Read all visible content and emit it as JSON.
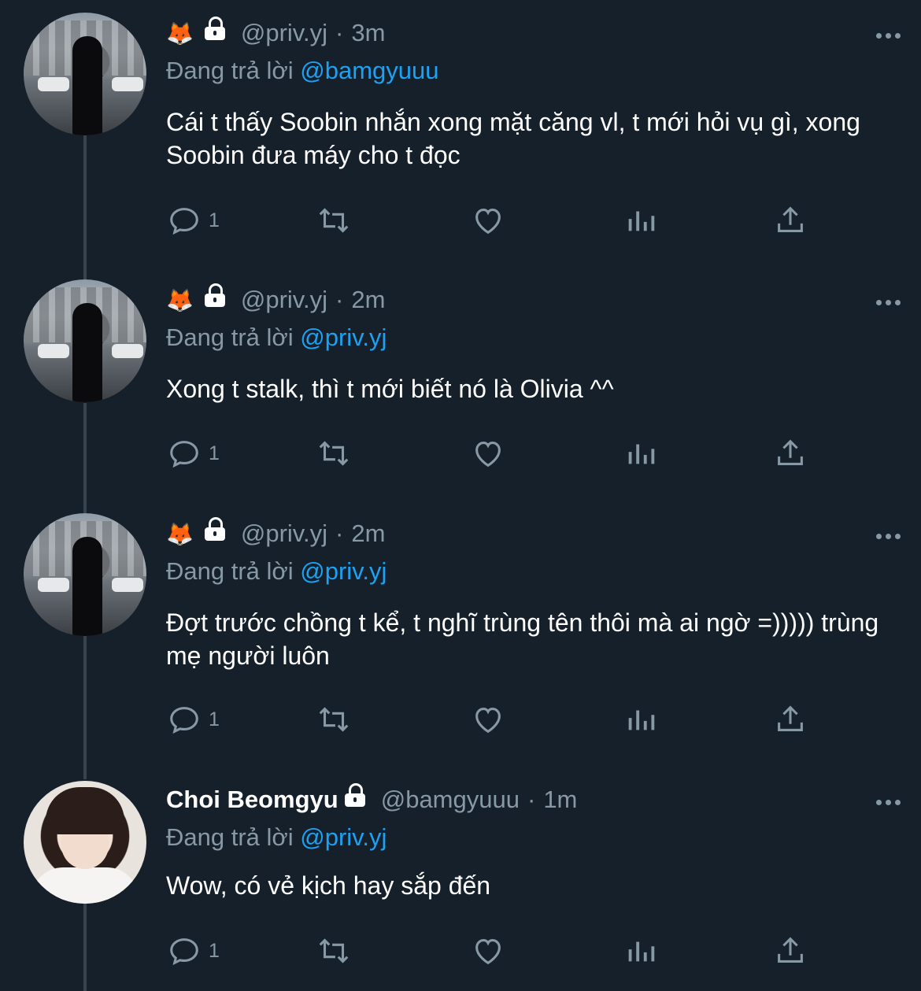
{
  "tweets": [
    {
      "emoji": "🦊",
      "handle": "@priv.yj",
      "time": "3m",
      "replying_label": "Đang trả lời",
      "replying_to": "@bamgyuuu",
      "text": "Cái t thấy Soobin nhắn xong mặt căng vl, t mới hỏi vụ gì, xong Soobin đưa máy cho t đọc",
      "reply_count": "1"
    },
    {
      "emoji": "🦊",
      "handle": "@priv.yj",
      "time": "2m",
      "replying_label": "Đang trả lời",
      "replying_to": "@priv.yj",
      "text": "Xong t stalk, thì t mới biết nó là Olivia ^^",
      "reply_count": "1"
    },
    {
      "emoji": "🦊",
      "handle": "@priv.yj",
      "time": "2m",
      "replying_label": "Đang trả lời",
      "replying_to": "@priv.yj",
      "text": "Đợt trước chồng t kể, t nghĩ trùng tên thôi mà ai ngờ =))))) trùng mẹ người luôn",
      "reply_count": "1"
    },
    {
      "name": "Choi Beomgyu",
      "handle": "@bamgyuuu",
      "time": "1m",
      "replying_label": "Đang trả lời",
      "replying_to": "@priv.yj",
      "text": "Wow, có vẻ kịch hay sắp đến",
      "reply_count": "1"
    }
  ],
  "separator": "·",
  "icons": {
    "reply": "reply-icon",
    "retweet": "retweet-icon",
    "like": "heart-icon",
    "analytics": "analytics-icon",
    "share": "share-icon",
    "lock": "lock-icon",
    "more": "more-icon"
  },
  "colors": {
    "background": "#15202b",
    "muted": "#8899a6",
    "accent": "#1da1f2",
    "text": "#ffffff"
  }
}
